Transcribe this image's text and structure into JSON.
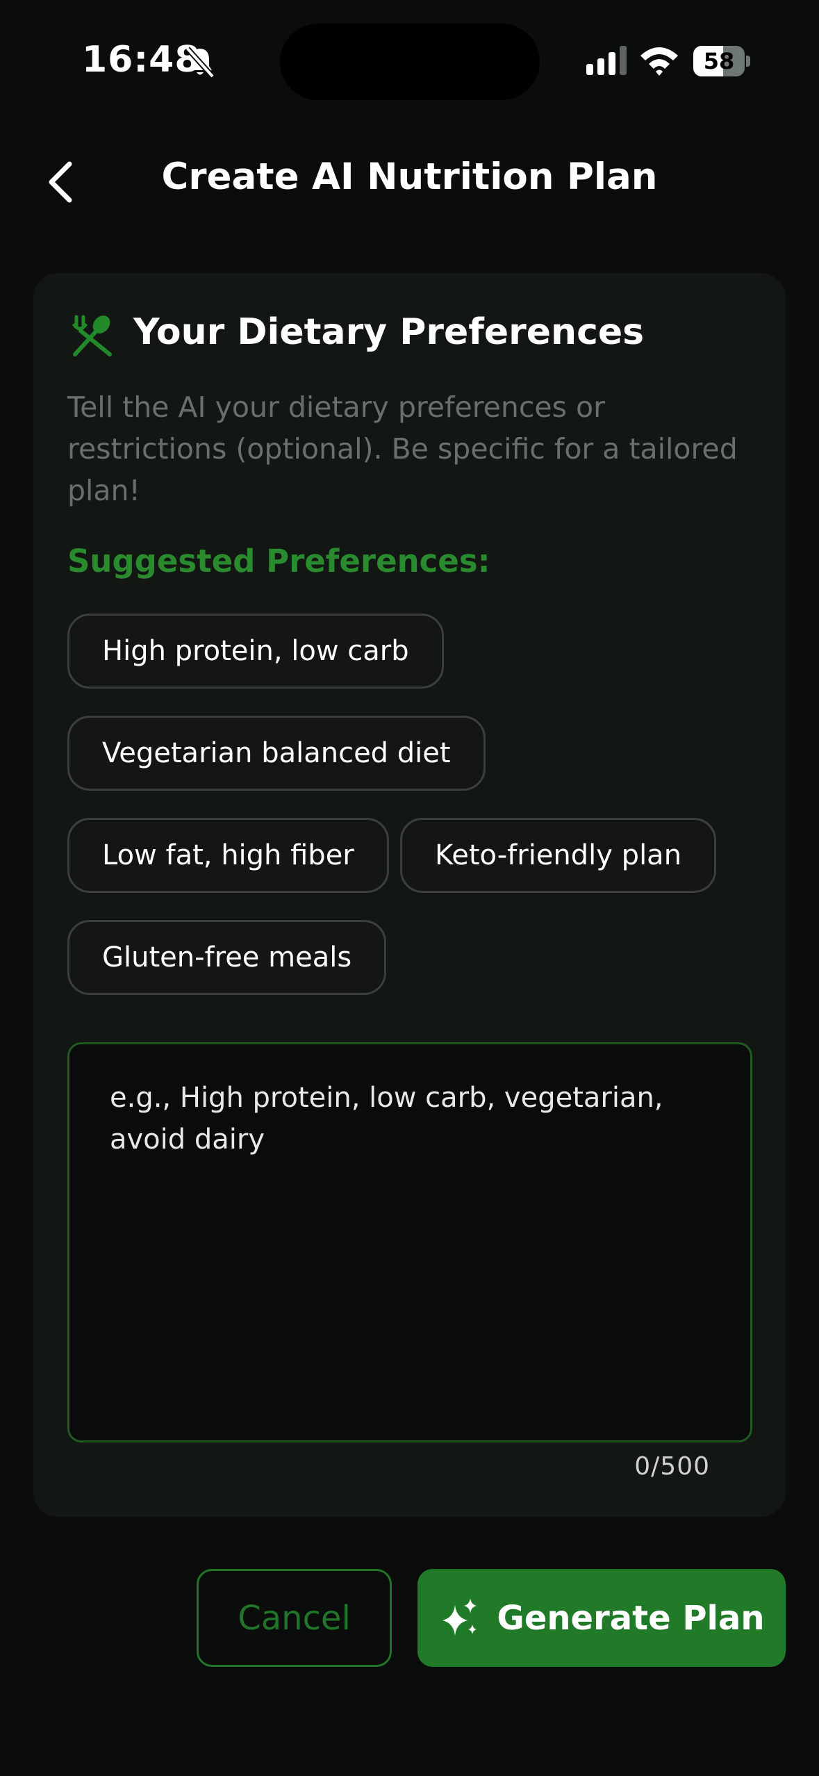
{
  "status_bar": {
    "time": "16:48",
    "battery_level": "58",
    "battery_fraction": 0.58
  },
  "header": {
    "title": "Create AI Nutrition Plan"
  },
  "card": {
    "title": "Your Dietary Preferences",
    "description": "Tell the AI your dietary preferences or restrictions (optional). Be specific for a tailored plan!",
    "suggested_label": "Suggested Preferences:",
    "chips": [
      "High protein, low carb",
      "Vegetarian balanced diet",
      "Low fat, high fiber",
      "Keto-friendly plan",
      "Gluten-free meals"
    ],
    "input": {
      "placeholder": "e.g., High protein, low carb, vegetarian, avoid dairy",
      "value": ""
    },
    "char_count": "0/500"
  },
  "actions": {
    "cancel_label": "Cancel",
    "generate_label": "Generate Plan"
  },
  "colors": {
    "accent": "#217a28",
    "accent_text": "#2a8a2e",
    "background": "#0a0d0b",
    "card": "#131714"
  },
  "icons": {
    "back": "chevron-left-icon",
    "muted": "bell-slash-icon",
    "section": "fork-spoon-icon",
    "generate": "sparkle-icon"
  }
}
